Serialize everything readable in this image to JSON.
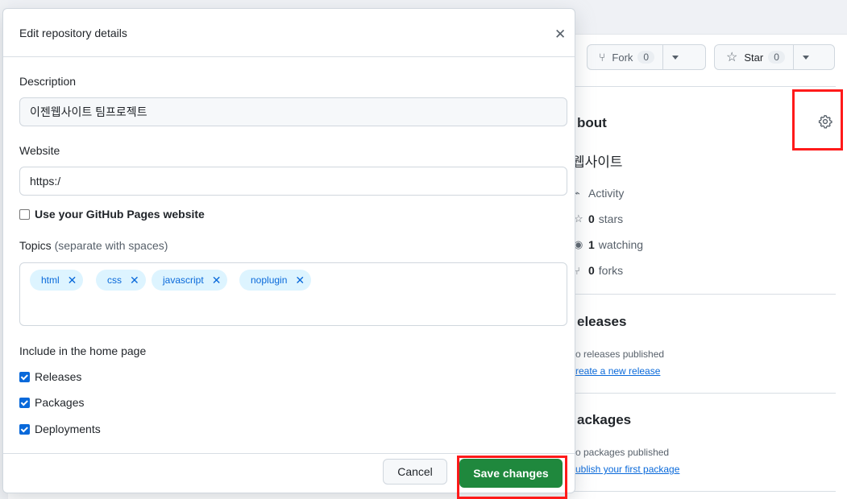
{
  "header": {
    "fork_label": "Fork",
    "fork_count": "0",
    "star_label": "Star",
    "star_count": "0"
  },
  "sidebar": {
    "about_title": "bout",
    "description": "웹사이트",
    "stats": [
      {
        "label": "Activity",
        "count": ""
      },
      {
        "label": "stars",
        "count": "0"
      },
      {
        "label": "watching",
        "count": "1"
      },
      {
        "label": "forks",
        "count": "0"
      }
    ],
    "releases_title": "eleases",
    "releases_text": "o releases published",
    "releases_link": "reate a new release",
    "packages_title": "ackages",
    "packages_text": "o packages published",
    "packages_link": "ublish your first package"
  },
  "modal": {
    "title": "Edit repository details",
    "description_label": "Description",
    "description_value": "이젠웹사이트 팀프로젝트",
    "website_label": "Website",
    "website_value": "https:/",
    "pages_checkbox_label": "Use your GitHub Pages website",
    "topics_label": "Topics",
    "topics_hint": "(separate with spaces)",
    "topics": [
      "html",
      "css",
      "javascript",
      "noplugin"
    ],
    "include_label": "Include in the home page",
    "include_options": [
      {
        "label": "Releases",
        "checked": true
      },
      {
        "label": "Packages",
        "checked": true
      },
      {
        "label": "Deployments",
        "checked": true
      }
    ],
    "cancel_label": "Cancel",
    "save_label": "Save changes"
  },
  "colors": {
    "primary_button": "#1f883d",
    "topic_bg": "#ddf4ff",
    "topic_text": "#0969da",
    "highlight_box": "#ff1a1a"
  }
}
